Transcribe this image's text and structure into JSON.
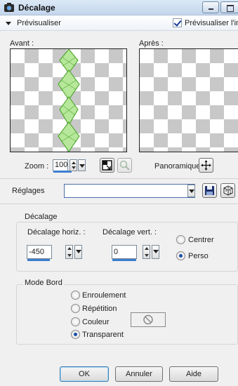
{
  "window": {
    "title": "Décalage"
  },
  "preview_header": {
    "label": "Prévisualiser",
    "checkbox_label": "Prévisualiser l'ima",
    "checkbox_checked": true
  },
  "preview": {
    "before_label": "Avant :",
    "after_label": "Après :"
  },
  "zoom": {
    "label": "Zoom :",
    "value": "100",
    "pan_label": "Panoramique :"
  },
  "settings": {
    "label": "Réglages",
    "value": ""
  },
  "offset_group": {
    "title": "Décalage",
    "horiz_label": "Décalage horiz. :",
    "horiz_value": "-450",
    "vert_label": "Décalage vert. :",
    "vert_value": "0",
    "options": [
      {
        "label": "Centrer",
        "selected": false
      },
      {
        "label": "Perso",
        "selected": true
      }
    ]
  },
  "edge_group": {
    "title": "Mode Bord",
    "options": [
      {
        "label": "Enroulement",
        "selected": false
      },
      {
        "label": "Répétition",
        "selected": false
      },
      {
        "label": "Couleur",
        "selected": false
      },
      {
        "label": "Transparent",
        "selected": true
      }
    ]
  },
  "buttons": {
    "ok": "OK",
    "cancel": "Annuler",
    "help": "Aide"
  },
  "colors": {
    "accent": "#3c7fd0",
    "art_green": "#4caf24"
  }
}
